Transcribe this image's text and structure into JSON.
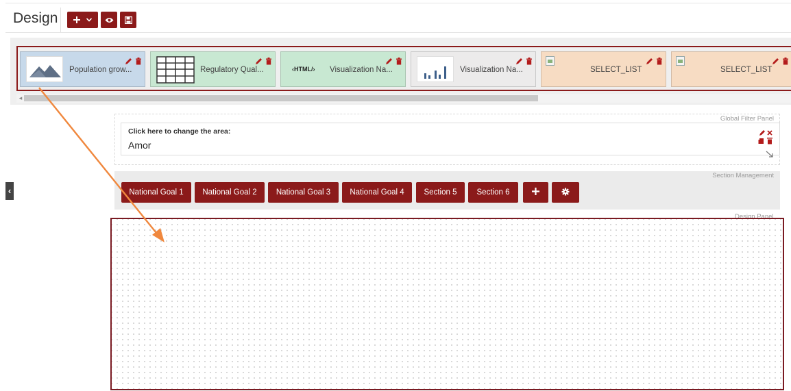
{
  "header": {
    "title": "Design",
    "add_icon": "plus-icon",
    "dropdown_icon": "chevron-down-icon",
    "preview_icon": "eye-icon",
    "save_icon": "floppy-disk-icon",
    "accent_color": "#8b1a1a"
  },
  "widgets": [
    {
      "label": "Population grow...",
      "thumbnail": "mountain-image-icon",
      "color": "#c7d9ea"
    },
    {
      "label": "Regulatory Qual...",
      "thumbnail": "table-grid-icon",
      "color": "#c8e8d2"
    },
    {
      "label": "Visualization Na...",
      "thumbnail_text": "‹HTML/›",
      "thumbnail": "html-code-icon",
      "color": "#c8e8d2"
    },
    {
      "label": "Visualization Na...",
      "thumbnail": "bar-chart-icon",
      "color": "#ecebeb"
    },
    {
      "label": "SELECT_LIST",
      "thumbnail": "broken-image-icon",
      "color": "#f7dcc3"
    },
    {
      "label": "SELECT_LIST",
      "thumbnail": "broken-image-icon",
      "color": "#f7dcc3"
    }
  ],
  "widget_actions": {
    "edit_icon": "pencil-icon",
    "delete_icon": "trash-icon"
  },
  "global_filter_panel": {
    "caption": "Global Filter Panel",
    "hint": "Click here to change the area:",
    "value": "Amor",
    "icons": [
      "pencil-icon",
      "close-icon",
      "copy-icon",
      "trash-icon",
      "resize-icon"
    ]
  },
  "section_management": {
    "caption": "Section Management",
    "tabs": [
      "National Goal 1",
      "National Goal 2",
      "National Goal 3",
      "National Goal 4",
      "Section 5",
      "Section 6"
    ],
    "add_icon": "plus-icon",
    "settings_icon": "gear-icon"
  },
  "design_panel": {
    "caption": "Design Panel"
  },
  "side_toggle": {
    "label": "‹"
  },
  "annotation": {
    "color": "#f0883e"
  }
}
